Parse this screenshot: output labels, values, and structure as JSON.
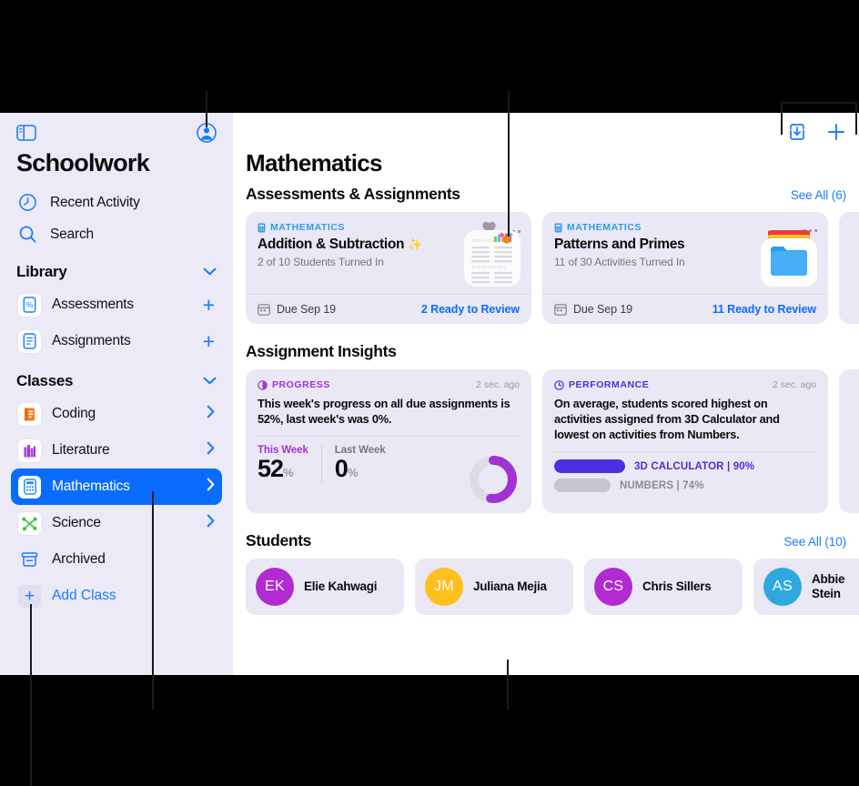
{
  "sidebar": {
    "toggle_icon": "sidebar-toggle-icon",
    "account_icon": "account-circle-icon",
    "title": "Schoolwork",
    "nav": [
      {
        "label": "Recent Activity",
        "icon": "clock-icon"
      },
      {
        "label": "Search",
        "icon": "search-icon"
      }
    ],
    "library": {
      "header": "Library",
      "items": [
        {
          "label": "Assessments",
          "icon": "percent-document-icon",
          "action": "+"
        },
        {
          "label": "Assignments",
          "icon": "lines-document-icon",
          "action": "+"
        }
      ]
    },
    "classes": {
      "header": "Classes",
      "items": [
        {
          "label": "Coding",
          "icon": "coding-book-icon",
          "selected": false,
          "chevron": true
        },
        {
          "label": "Literature",
          "icon": "literature-books-icon",
          "selected": false,
          "chevron": true
        },
        {
          "label": "Mathematics",
          "icon": "calculator-icon",
          "selected": true,
          "chevron": true
        },
        {
          "label": "Science",
          "icon": "molecule-icon",
          "selected": false,
          "chevron": true
        },
        {
          "label": "Archived",
          "icon": "archive-box-icon",
          "selected": false,
          "chevron": false
        }
      ],
      "add_class": "Add Class"
    }
  },
  "toolbar": {
    "import_icon": "import-tray-icon",
    "add_icon": "plus-icon"
  },
  "main": {
    "page_title": "Mathematics",
    "assessments": {
      "section_title": "Assessments & Assignments",
      "see_all": "See All (6)",
      "cards": [
        {
          "kicker": "MATHEMATICS",
          "kicker_icon": "calculator-icon",
          "name": "Addition & Subtraction",
          "name_emoji": "✨",
          "subtitle": "2 of 10 Students Turned In",
          "favorited": true,
          "favorite_icon": "heart-filled-icon",
          "more_icon": "ellipsis-icon",
          "thumb": "worksheet-thumbnail",
          "due": "Due Sep 19",
          "due_icon": "calendar-icon",
          "ready": "2 Ready to Review"
        },
        {
          "kicker": "MATHEMATICS",
          "kicker_icon": "calculator-icon",
          "name": "Patterns and Primes",
          "name_emoji": "",
          "subtitle": "11 of 30 Activities Turned In",
          "favorited": false,
          "favorite_icon": "",
          "more_icon": "ellipsis-icon",
          "thumb": "folder-thumbnail",
          "due": "Due Sep 19",
          "due_icon": "calendar-icon",
          "ready": "11 Ready to Review"
        }
      ]
    },
    "insights": {
      "section_title": "Assignment Insights",
      "progress": {
        "kicker": "PROGRESS",
        "kicker_icon": "progress-circle-icon",
        "timestamp": "2 sec. ago",
        "text": "This week's progress on all due assignments is 52%, last week's was 0%.",
        "this_week_label": "This Week",
        "this_week_value": "52",
        "this_week_unit": "%",
        "last_week_label": "Last Week",
        "last_week_value": "0",
        "last_week_unit": "%",
        "accent": "#A332D6"
      },
      "performance": {
        "kicker": "PERFORMANCE",
        "kicker_icon": "performance-target-icon",
        "timestamp": "2 sec. ago",
        "text": "On average, students scored highest on activities assigned from 3D Calculator and lowest on activities from Numbers.",
        "bars": [
          {
            "label": "3D CALCULATOR | 90%",
            "pct": 90,
            "color": "#4B2FE0",
            "text_color": "#4B2FE0"
          },
          {
            "label": "NUMBERS | 74%",
            "pct": 74,
            "color": "#C6C4CF",
            "text_color": "#8C8A96"
          }
        ]
      }
    },
    "students": {
      "section_title": "Students",
      "see_all": "See All (10)",
      "list": [
        {
          "initials": "EK",
          "name": "Elie Kahwagi",
          "color": "#B12BD1"
        },
        {
          "initials": "JM",
          "name": "Juliana Mejia",
          "color": "#FFC01E"
        },
        {
          "initials": "CS",
          "name": "Chris Sillers",
          "color": "#B12BD1"
        },
        {
          "initials": "AS",
          "name": "Abbie Stein",
          "color": "#2FA8E0"
        }
      ]
    }
  },
  "chart_data": {
    "type": "bar",
    "title": "Assignment Insights",
    "series": [
      {
        "name": "This Week progress",
        "value": 52,
        "unit": "%"
      },
      {
        "name": "Last Week progress",
        "value": 0,
        "unit": "%"
      },
      {
        "name": "3D Calculator average score",
        "value": 90,
        "unit": "%"
      },
      {
        "name": "Numbers average score",
        "value": 74,
        "unit": "%"
      }
    ],
    "ylim": [
      0,
      100
    ]
  }
}
